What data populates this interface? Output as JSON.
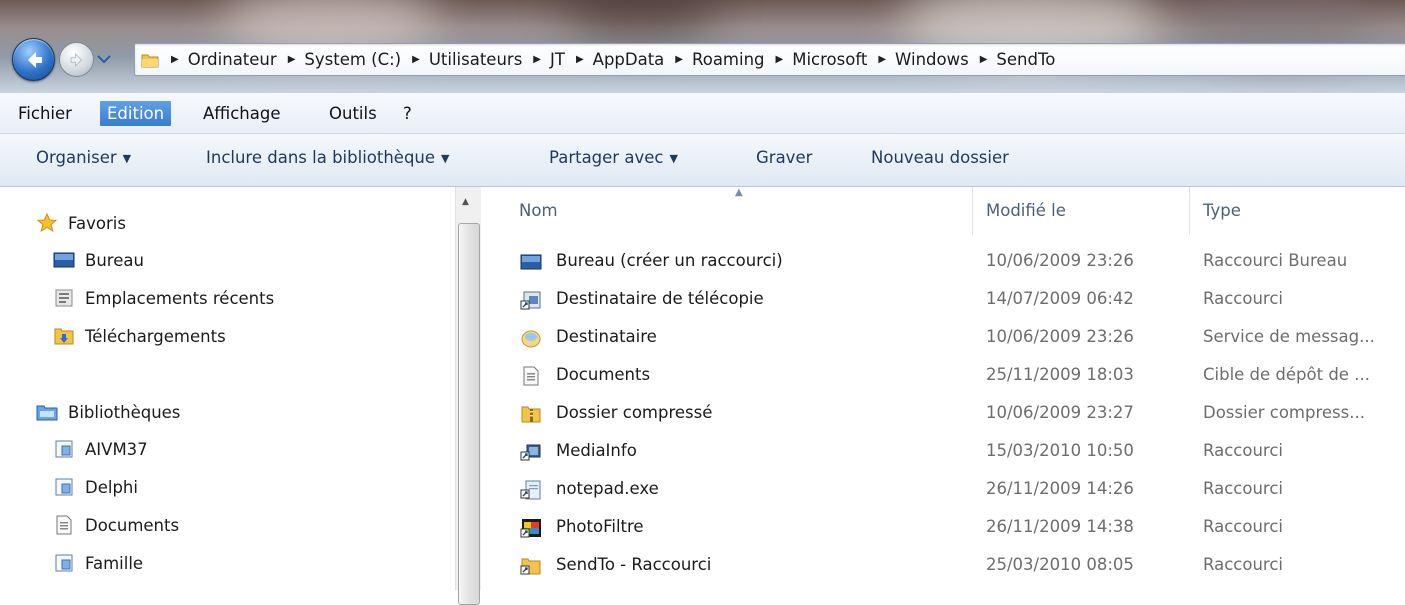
{
  "address": {
    "crumbs": [
      "Ordinateur",
      "System (C:)",
      "Utilisateurs",
      "JT",
      "AppData",
      "Roaming",
      "Microsoft",
      "Windows",
      "SendTo"
    ]
  },
  "menu": {
    "items": [
      "Fichier",
      "Edition",
      "Affichage",
      "Outils",
      "?"
    ]
  },
  "commands": {
    "organize": "Organiser",
    "include_library": "Inclure dans la bibliothèque",
    "share_with": "Partager avec",
    "burn": "Graver",
    "new_folder": "Nouveau dossier"
  },
  "nav": {
    "favorites_header": "Favoris",
    "favorites": [
      "Bureau",
      "Emplacements récents",
      "Téléchargements"
    ],
    "libraries_header": "Bibliothèques",
    "libraries": [
      "AIVM37",
      "Delphi",
      "Documents",
      "Famille"
    ]
  },
  "columns": {
    "name": "Nom",
    "modified": "Modifié le",
    "type": "Type"
  },
  "files": [
    {
      "name": "Bureau (créer un raccourci)",
      "modified": "10/06/2009 23:26",
      "type": "Raccourci Bureau",
      "icon": "desktop-icon"
    },
    {
      "name": "Destinataire de télécopie",
      "modified": "14/07/2009 06:42",
      "type": "Raccourci",
      "icon": "fax-icon"
    },
    {
      "name": "Destinataire",
      "modified": "10/06/2009 23:26",
      "type": "Service de messag...",
      "icon": "mail-icon"
    },
    {
      "name": "Documents",
      "modified": "25/11/2009 18:03",
      "type": "Cible de dépôt de ...",
      "icon": "document-icon"
    },
    {
      "name": "Dossier compressé",
      "modified": "10/06/2009 23:27",
      "type": "Dossier compress...",
      "icon": "zip-folder-icon"
    },
    {
      "name": "MediaInfo",
      "modified": "15/03/2010 10:50",
      "type": "Raccourci",
      "icon": "mediainfo-icon"
    },
    {
      "name": "notepad.exe",
      "modified": "26/11/2009 14:26",
      "type": "Raccourci",
      "icon": "notepad-icon"
    },
    {
      "name": "PhotoFiltre",
      "modified": "26/11/2009 14:38",
      "type": "Raccourci",
      "icon": "photofiltre-icon"
    },
    {
      "name": "SendTo - Raccourci",
      "modified": "25/03/2010 08:05",
      "type": "Raccourci",
      "icon": "folder-shortcut-icon"
    }
  ]
}
